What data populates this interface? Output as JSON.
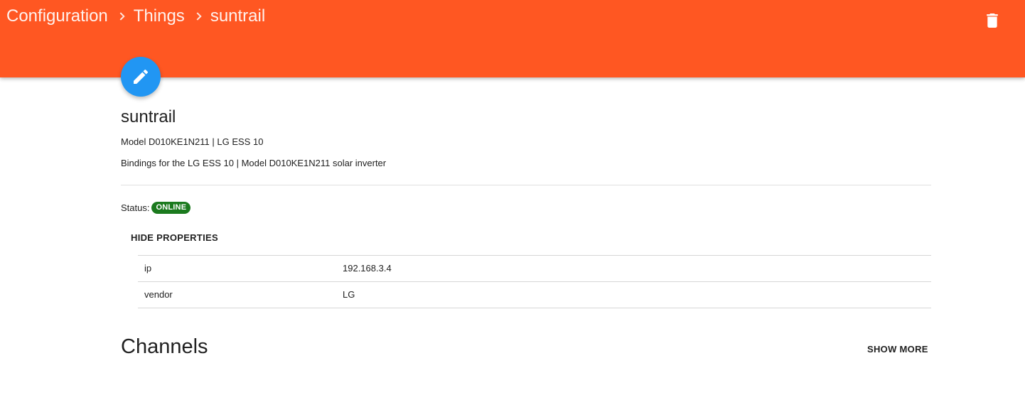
{
  "header": {
    "breadcrumb": [
      "Configuration",
      "Things",
      "suntrail"
    ],
    "delete_icon": "trash-icon",
    "background_color": "#ff5722"
  },
  "fab": {
    "icon": "pencil-icon",
    "color": "#2196f3"
  },
  "thing": {
    "name": "suntrail",
    "model_line": "Model D010KE1N211 | LG ESS 10",
    "description": "Bindings for the LG ESS 10 | Model D010KE1N211 solar inverter",
    "status_label": "Status:",
    "status": "ONLINE",
    "status_color": "#1b7a1e"
  },
  "properties": {
    "toggle_label": "HIDE PROPERTIES",
    "rows": [
      {
        "key": "ip",
        "value": "192.168.3.4"
      },
      {
        "key": "vendor",
        "value": "LG"
      }
    ]
  },
  "channels": {
    "title": "Channels",
    "show_more_label": "SHOW MORE"
  }
}
